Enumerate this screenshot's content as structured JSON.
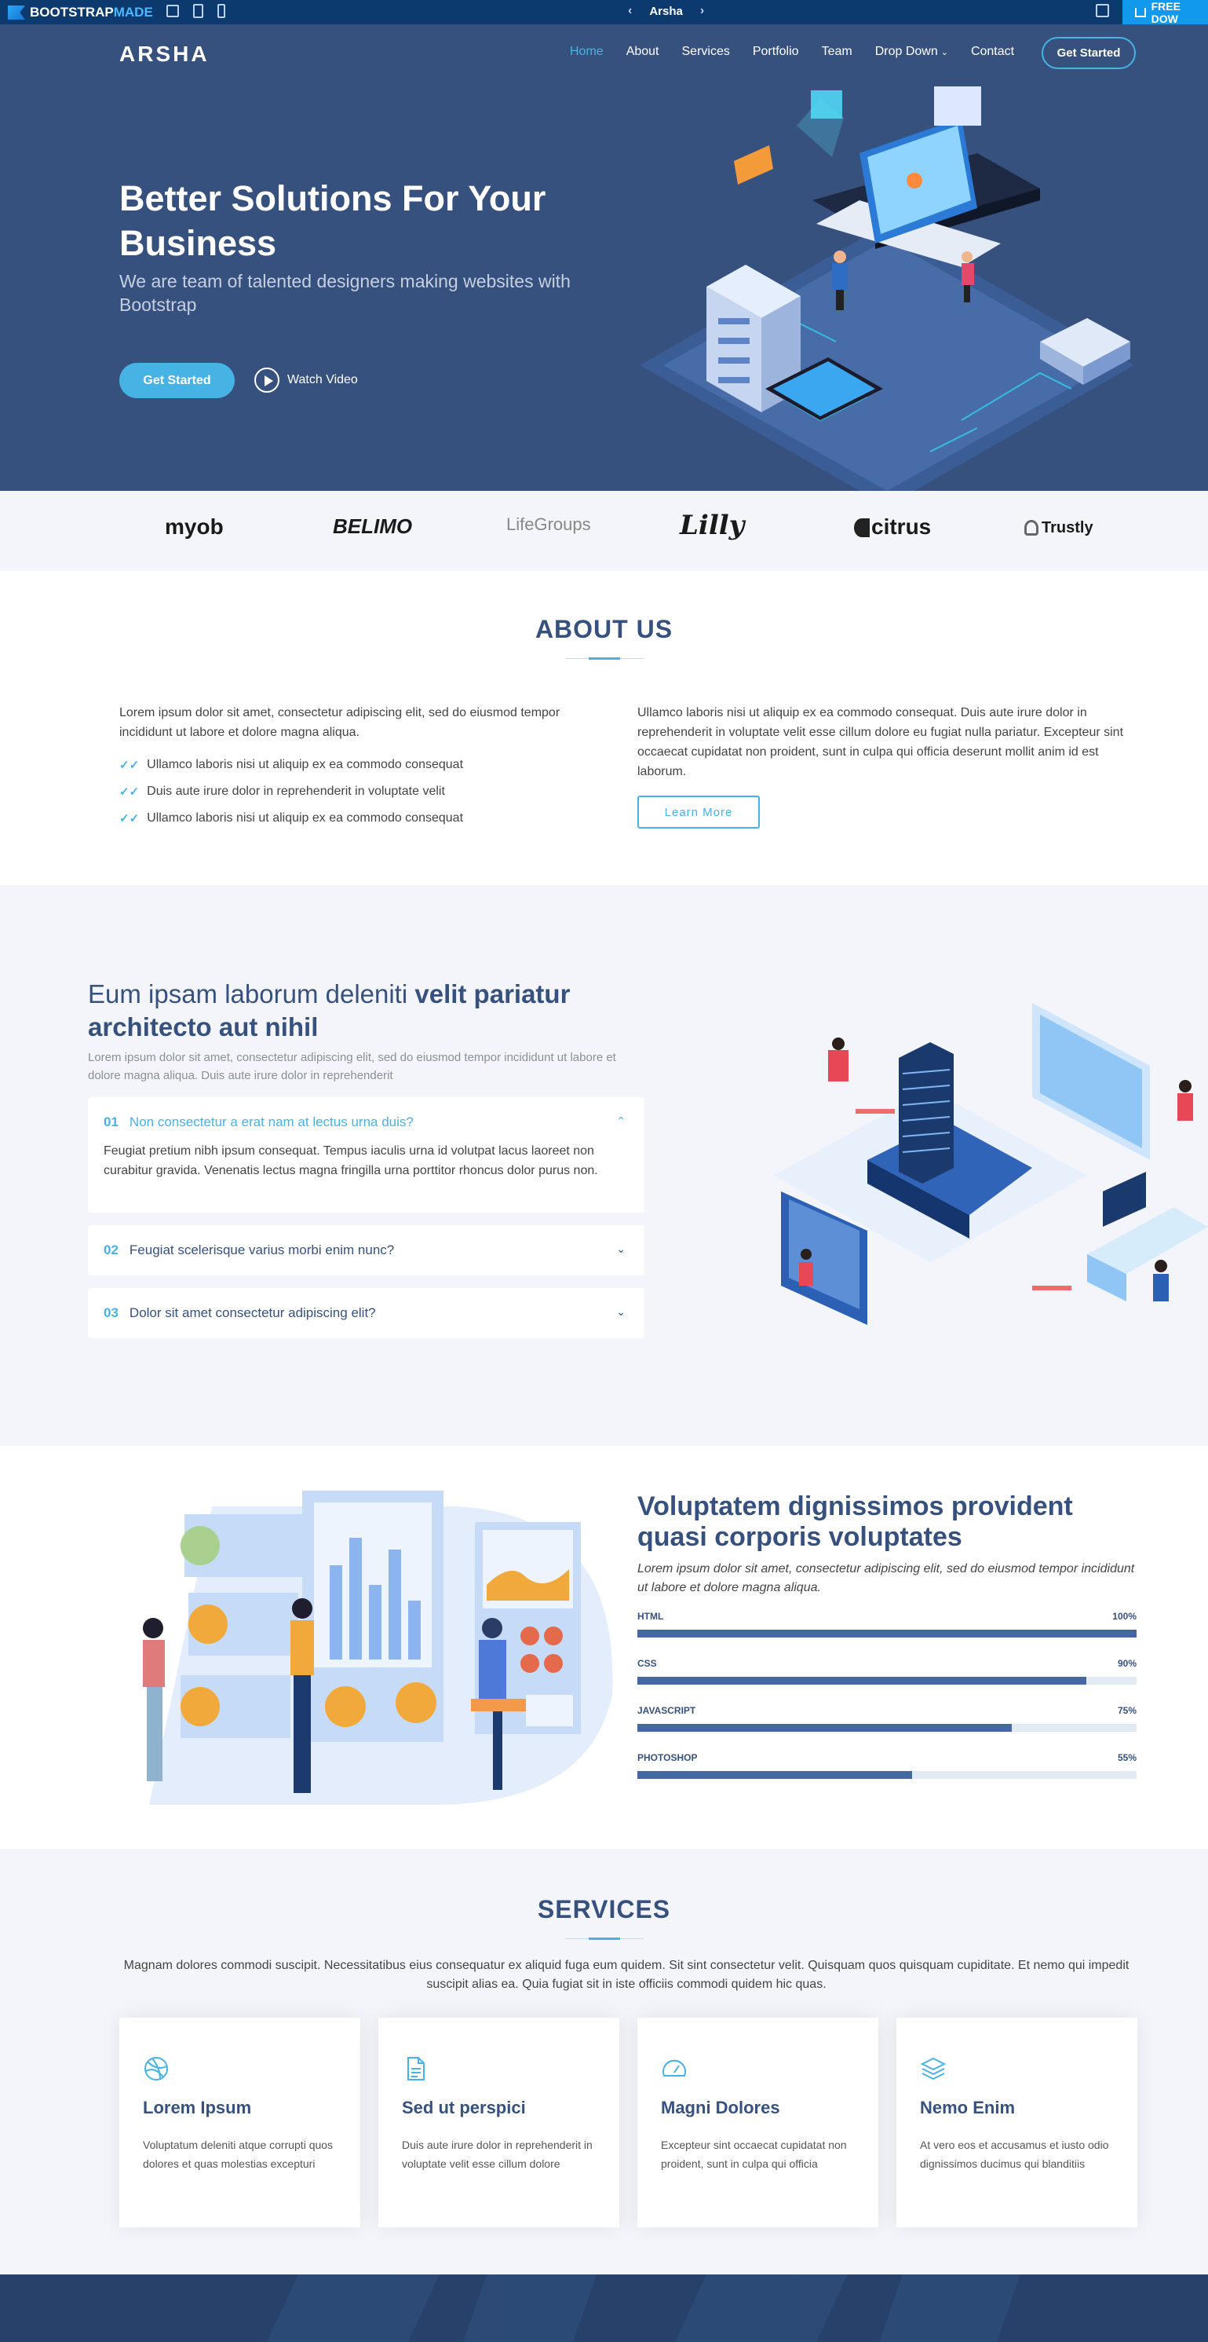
{
  "preview_bar": {
    "logo_a": "BOOTSTRAP",
    "logo_b": "MADE",
    "template_name": "Arsha",
    "prev_arrow": "‹",
    "next_arrow": "›",
    "download_label": "FREE DOW"
  },
  "header": {
    "brand": "ARSHA",
    "nav": [
      "Home",
      "About",
      "Services",
      "Portfolio",
      "Team",
      "Drop Down",
      "Contact"
    ],
    "cta": "Get Started"
  },
  "hero": {
    "title": "Better Solutions For Your Business",
    "subtitle": "We are team of talented designers making websites with Bootstrap",
    "primary_button": "Get Started",
    "video_link": "Watch Video"
  },
  "clients": [
    "myob",
    "BELIMO",
    "LifeGroups",
    "Lilly",
    "citrus",
    "Trustly"
  ],
  "about": {
    "title": "ABOUT US",
    "intro": "Lorem ipsum dolor sit amet, consectetur adipiscing elit, sed do eiusmod tempor incididunt ut labore et dolore magna aliqua.",
    "list": [
      "Ullamco laboris nisi ut aliquip ex ea commodo consequat",
      "Duis aute irure dolor in reprehenderit in voluptate velit",
      "Ullamco laboris nisi ut aliquip ex ea commodo consequat"
    ],
    "right_text": "Ullamco laboris nisi ut aliquip ex ea commodo consequat. Duis aute irure dolor in reprehenderit in voluptate velit esse cillum dolore eu fugiat nulla pariatur. Excepteur sint occaecat cupidatat non proident, sunt in culpa qui officia deserunt mollit anim id est laborum.",
    "button": "Learn More"
  },
  "why": {
    "title_light": "Eum ipsam laborum deleniti",
    "title_bold": "velit pariatur architecto aut nihil",
    "text": "Lorem ipsum dolor sit amet, consectetur adipiscing elit, sed do eiusmod tempor incididunt ut labore et dolore magna aliqua. Duis aute irure dolor in reprehenderit",
    "faqs": [
      {
        "num": "01",
        "question": "Non consectetur a erat nam at lectus urna duis?",
        "answer": "Feugiat pretium nibh ipsum consequat. Tempus iaculis urna id volutpat lacus laoreet non curabitur gravida. Venenatis lectus magna fringilla urna porttitor rhoncus dolor purus non.",
        "open": true
      },
      {
        "num": "02",
        "question": "Feugiat scelerisque varius morbi enim nunc?",
        "open": false
      },
      {
        "num": "03",
        "question": "Dolor sit amet consectetur adipiscing elit?",
        "open": false
      }
    ]
  },
  "skills": {
    "title": "Voluptatem dignissimos provident quasi corporis voluptates",
    "text": "Lorem ipsum dolor sit amet, consectetur adipiscing elit, sed do eiusmod tempor incididunt ut labore et dolore magna aliqua.",
    "items": [
      {
        "name": "HTML",
        "percent_label": "100%",
        "value": 100
      },
      {
        "name": "CSS",
        "percent_label": "90%",
        "value": 90
      },
      {
        "name": "JAVASCRIPT",
        "percent_label": "75%",
        "value": 75
      },
      {
        "name": "PHOTOSHOP",
        "percent_label": "55%",
        "value": 55
      }
    ]
  },
  "services": {
    "title": "SERVICES",
    "text": "Magnam dolores commodi suscipit. Necessitatibus eius consequatur ex aliquid fuga eum quidem. Sit sint consectetur velit. Quisquam quos quisquam cupiditate. Et nemo qui impedit suscipit alias ea. Quia fugiat sit in iste officiis commodi quidem hic quas.",
    "cards": [
      {
        "icon": "dribbble-icon",
        "title": "Lorem Ipsum",
        "text": "Voluptatum deleniti atque corrupti quos dolores et quas molestias excepturi"
      },
      {
        "icon": "file-icon",
        "title": "Sed ut perspici",
        "text": "Duis aute irure dolor in reprehenderit in voluptate velit esse cillum dolore"
      },
      {
        "icon": "tachometer-icon",
        "title": "Magni Dolores",
        "text": "Excepteur sint occaecat cupidatat non proident, sunt in culpa qui officia"
      },
      {
        "icon": "layer-icon",
        "title": "Nemo Enim",
        "text": "At vero eos et accusamus et iusto odio dignissimos ducimus qui blanditiis"
      }
    ]
  },
  "colors": {
    "primary": "#37517e",
    "accent": "#47b2e4",
    "light_bg": "#f3f5fa",
    "preview_bar": "#0d3a6e",
    "download": "#1199ee"
  }
}
